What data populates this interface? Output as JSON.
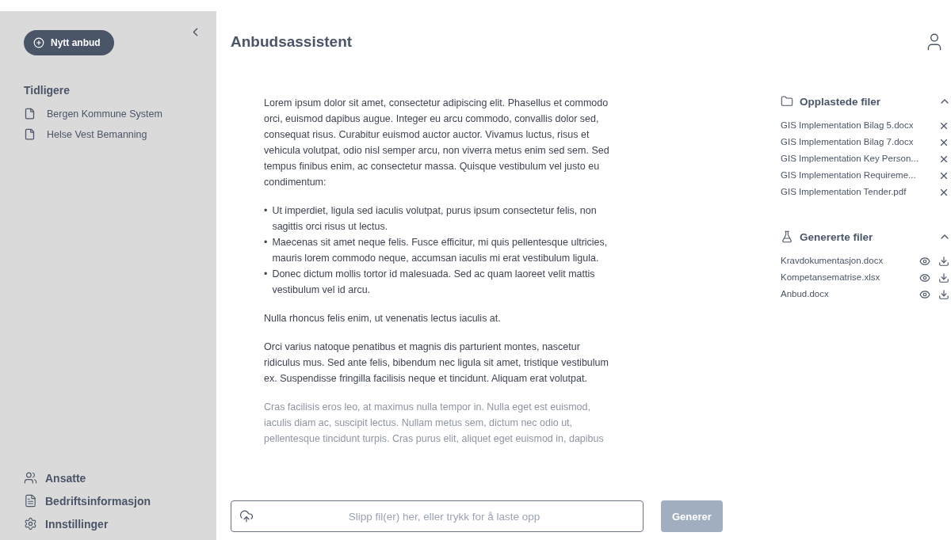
{
  "sidebar": {
    "new_button": "Nytt anbud",
    "section_title": "Tidligere",
    "history": [
      "Bergen Kommune System",
      "Helse Vest Bemanning"
    ],
    "nav": [
      {
        "kind": "users",
        "label": "Ansatte"
      },
      {
        "kind": "document",
        "label": "Bedriftsinformasjon"
      },
      {
        "kind": "settings",
        "label": "Innstillinger"
      }
    ]
  },
  "header": {
    "title": "Anbudsassistent"
  },
  "document": [
    {
      "kind": "paragraph",
      "text": "Lorem ipsum dolor sit amet, consectetur adipiscing elit. Phasellus et commodo orci, euismod dapibus augue. Integer eu arcu commodo, convallis dolor sed, consequat risus. Curabitur euismod auctor auctor. Vivamus luctus, risus et vehicula volutpat, odio nisl semper arcu, non viverra metus enim sed sem. Sed tempus finibus enim, ac consectetur massa. Quisque vestibulum vel justo eu condimentum:"
    },
    {
      "kind": "list",
      "marker": "•",
      "items": [
        "Ut imperdiet, ligula sed iaculis volutpat, purus ipsum consectetur felis, non sagittis orci risus ut lectus.",
        "Maecenas sit amet neque felis. Fusce efficitur, mi quis pellentesque ultricies, mauris lorem commodo neque, accumsan iaculis mi erat vestibulum ligula.",
        "Donec dictum mollis tortor id malesuada. Sed ac quam laoreet velit mattis vestibulum vel id arcu."
      ]
    },
    {
      "kind": "paragraph",
      "text": "Nulla rhoncus felis enim, ut venenatis lectus iaculis at."
    },
    {
      "kind": "paragraph",
      "text": "Orci varius natoque penatibus et magnis dis parturient montes, nascetur ridiculus mus. Sed ante felis, bibendum nec ligula sit amet, tristique vestibulum ex. Suspendisse fringilla facilisis neque et tincidunt. Aliquam erat volutpat."
    },
    {
      "kind": "faded",
      "text": "Cras facilisis eros leo, at maximus nulla tempor in. Nulla eget est euismod, iaculis diam ac, suscipit lectus. Nullam metus sem, dictum nec odio ut, pellentesque tincidunt turpis. Cras purus elit, aliquet eget euismod in, dapibus"
    }
  ],
  "uploaded_files": {
    "title": "Opplastede filer",
    "expanded": true,
    "files": [
      "GIS Implementation Bilag 5.docx",
      "GIS Implementation Bilag 7.docx",
      "GIS Implementation Key Person...",
      "GIS Implementation Requireme...",
      "GIS Implementation Tender.pdf"
    ]
  },
  "generated_files": {
    "title": "Genererte filer",
    "expanded": true,
    "files": [
      "Kravdokumentasjon.docx",
      "Kompetansematrise.xlsx",
      "Anbud.docx"
    ]
  },
  "upload": {
    "placeholder": "Slipp fil(er) her, eller trykk for å laste opp"
  },
  "generate_button": {
    "label": "Generer",
    "disabled": true
  }
}
